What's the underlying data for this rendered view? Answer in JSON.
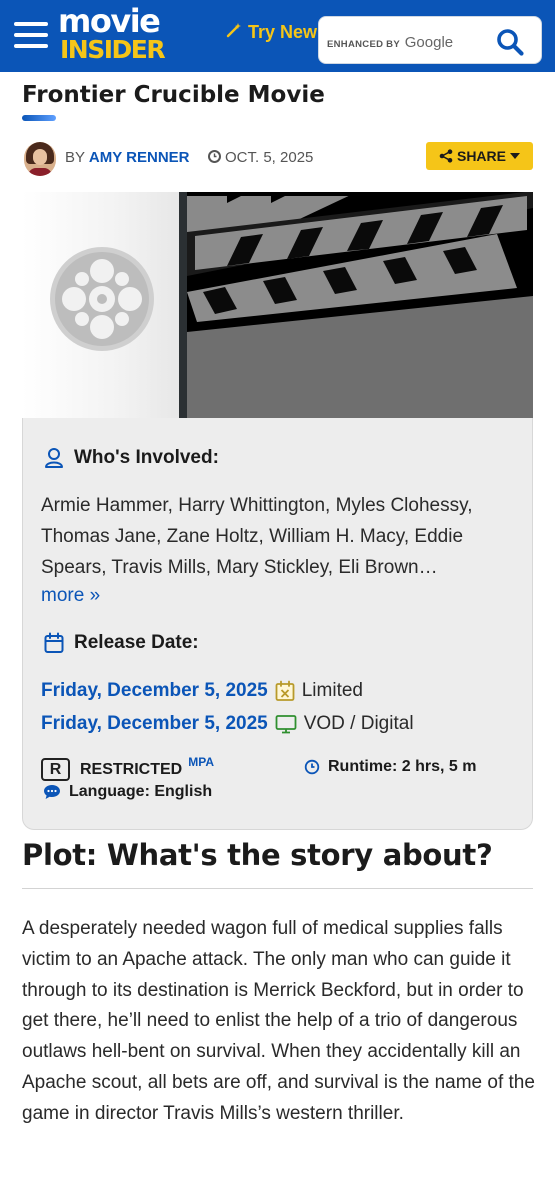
{
  "header": {
    "logo_top": "movie",
    "logo_bottom": "INSIDER",
    "try_new_label": "Try New",
    "search_enhanced_label": "ENHANCED BY",
    "search_google_label": "Google"
  },
  "article": {
    "title": "Frontier Crucible Movie",
    "by_label": "BY",
    "author": "AMY RENNER",
    "date": "OCT. 5, 2025",
    "share_label": "SHARE"
  },
  "info": {
    "involved_heading": "Who's Involved:",
    "cast_text": "Armie Hammer, Harry Whittington, Myles Clohessy, Thomas Jane, Zane Holtz, William H. Macy, Eddie Spears, Travis Mills, Mary Stickley, Eli Brown…",
    "more_label": "more »",
    "release_heading": "Release Date:",
    "releases": [
      {
        "date": "Friday, December 5, 2025",
        "type": "Limited",
        "icon": "calendar-limited-icon"
      },
      {
        "date": "Friday, December 5, 2025",
        "type": "VOD / Digital",
        "icon": "monitor-icon"
      }
    ],
    "rating_badge": "R",
    "rating_text": "RESTRICTED",
    "rating_source": "MPA",
    "runtime": "Runtime: 2 hrs, 5 m",
    "language": "Language: English"
  },
  "plot": {
    "heading": "Plot: What's the story about?",
    "text": "A desperately needed wagon full of medical supplies falls victim to an Apache attack. The only man who can guide it through to its destination is Merrick Beckford, but in order to get there, he’ll need to enlist the help of a trio of dangerous outlaws hell-bent on survival. When they accidentally kill an Apache scout, all bets are off, and survival is the name of the game in director Travis Mills’s western thriller."
  },
  "colors": {
    "brand_blue": "#0b55b7",
    "accent_yellow": "#f5c518",
    "card_bg": "#ededed"
  }
}
